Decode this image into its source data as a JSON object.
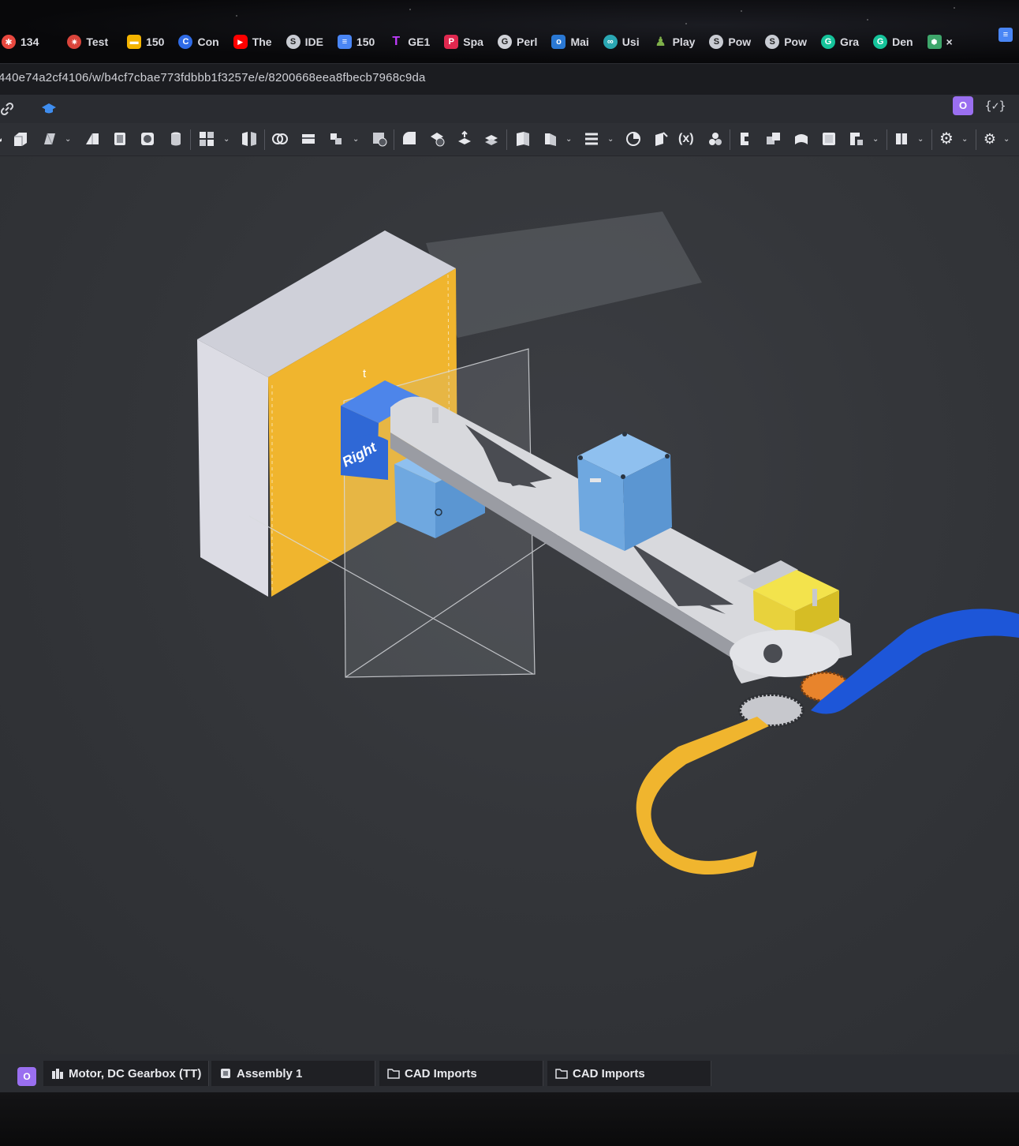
{
  "browser": {
    "tabs": [
      {
        "label": "134",
        "icon": "asana-icon",
        "color": "#e8483f"
      },
      {
        "label": "Test",
        "icon": "target-icon",
        "color": "#d9443b"
      },
      {
        "label": "150",
        "icon": "slides-icon",
        "color": "#f4b400"
      },
      {
        "label": "Con",
        "icon": "canvas-icon",
        "color": "#2f6be6"
      },
      {
        "label": "The",
        "icon": "youtube-icon",
        "color": "#ff0000"
      },
      {
        "label": "IDE",
        "icon": "onshape-icon",
        "color": "#c9ccd3"
      },
      {
        "label": "150",
        "icon": "docs-icon",
        "color": "#4a86f5"
      },
      {
        "label": "GE1",
        "icon": "tinkercad-icon",
        "color": "#c13cff"
      },
      {
        "label": "Spa",
        "icon": "pdf-icon",
        "color": "#e0284f"
      },
      {
        "label": "Perl",
        "icon": "chatgpt-icon",
        "color": "#d0d2d8"
      },
      {
        "label": "Mai",
        "icon": "outlook-icon",
        "color": "#2a78d4"
      },
      {
        "label": "Usi",
        "icon": "arduino-icon",
        "color": "#2aa7b3"
      },
      {
        "label": "Play",
        "icon": "chess-icon",
        "color": "#7fb04a"
      },
      {
        "label": "Pow",
        "icon": "onshape-icon",
        "color": "#c9ccd3"
      },
      {
        "label": "Pow",
        "icon": "onshape-icon",
        "color": "#c9ccd3"
      },
      {
        "label": "Gra",
        "icon": "grammarly-icon",
        "color": "#15c39a"
      },
      {
        "label": "Den",
        "icon": "grammarly-icon",
        "color": "#15c39a"
      },
      {
        "label": "×",
        "icon": "extension-icon",
        "color": "#3ea66b"
      }
    ],
    "url": "440e74a2cf4106/w/b4cf7cbae773fdbbb1f3257e/e/8200668eea8fbecb7968c9da"
  },
  "header": {
    "user_initial": "O",
    "variables_label": "{✓}"
  },
  "viewport": {
    "plane_label": "Right",
    "plane_label_top": "t"
  },
  "bottom_tabs": {
    "badge": "O",
    "items": [
      {
        "label": "Motor, DC Gearbox (TT)",
        "icon": "part-studio-icon"
      },
      {
        "label": "Assembly 1",
        "icon": "assembly-icon"
      },
      {
        "label": "CAD Imports",
        "icon": "folder-icon"
      },
      {
        "label": "CAD Imports",
        "icon": "folder-icon"
      }
    ]
  },
  "colors": {
    "stepper_blue": "#6fa8e0",
    "bracket_blue": "#2f68d6",
    "panel_yellow": "#f0b52e",
    "tt_motor_yellow": "#e8d23c",
    "arm_gray": "#d8d9dd",
    "gear_orange": "#e8842c",
    "track_blue": "#1d56d8"
  }
}
